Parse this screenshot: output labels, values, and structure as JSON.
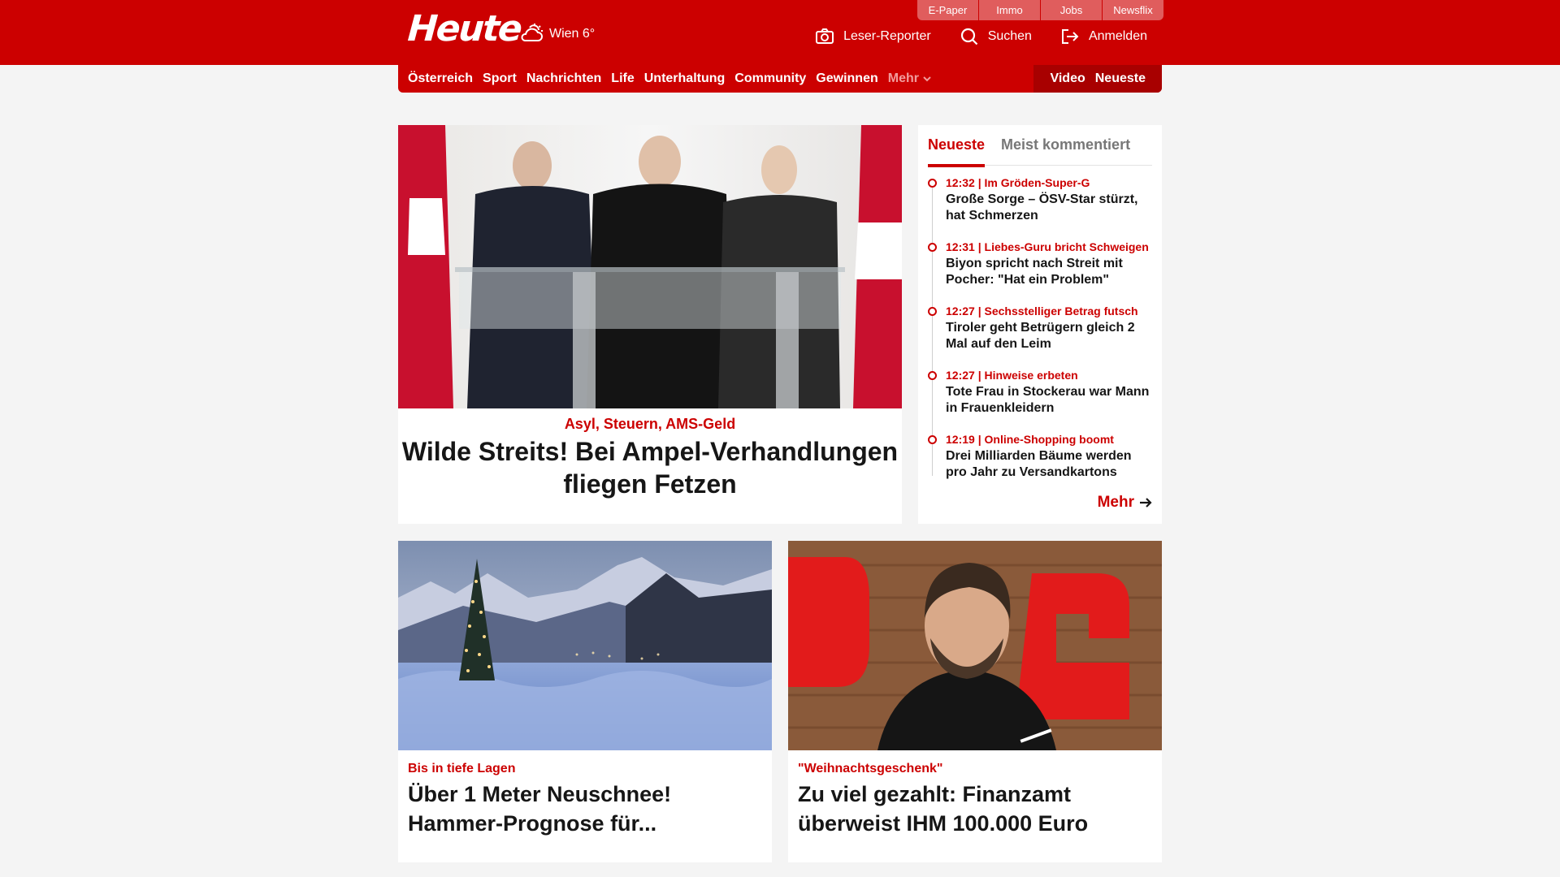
{
  "header": {
    "logo": "Heute",
    "weather": {
      "icon": "cloud-sun-icon",
      "text": "Wien 6°"
    },
    "services": [
      "E-Paper",
      "Immo",
      "Jobs",
      "Newsflix"
    ],
    "actions": [
      {
        "icon": "camera-icon",
        "label": "Leser-Reporter"
      },
      {
        "icon": "search-icon",
        "label": "Suchen"
      },
      {
        "icon": "login-icon",
        "label": "Anmelden"
      }
    ]
  },
  "nav": {
    "items": [
      "Österreich",
      "Sport",
      "Nachrichten",
      "Life",
      "Unterhaltung",
      "Community",
      "Gewinnen"
    ],
    "more": "Mehr",
    "right": [
      "Video",
      "Neueste"
    ]
  },
  "hero": {
    "kicker": "Asyl, Steuern, AMS-Geld",
    "title": "Wilde Streits! Bei Ampel-Verhandlungen fliegen Fetzen"
  },
  "sidebar": {
    "tabs": [
      "Neueste",
      "Meist kommentiert"
    ],
    "active_tab": "Neueste",
    "items": [
      {
        "time": "12:32",
        "topic": "Im Gröden-Super-G",
        "title": "Große Sorge – ÖSV-Star stürzt, hat Schmerzen"
      },
      {
        "time": "12:31",
        "topic": "Liebes-Guru bricht Schweigen",
        "title": "Biyon spricht nach Streit mit Pocher: \"Hat ein Problem\""
      },
      {
        "time": "12:27",
        "topic": "Sechsstelliger Betrag futsch",
        "title": "Tiroler geht Betrügern gleich 2 Mal auf den Leim"
      },
      {
        "time": "12:27",
        "topic": "Hinweise erbeten",
        "title": "Tote Frau in Stockerau war Mann in Frauenkleidern"
      },
      {
        "time": "12:19",
        "topic": "Online-Shopping boomt",
        "title": "Drei Milliarden Bäume werden pro Jahr zu Versandkartons"
      }
    ],
    "more": "Mehr"
  },
  "cards": [
    {
      "kicker": "Bis in tiefe Lagen",
      "title": "Über 1 Meter Neuschnee! Hammer-Prognose für..."
    },
    {
      "kicker": "\"Weihnachtsgeschenk\"",
      "title": "Zu viel gezahlt: Finanzamt überweist IHM 100.000 Euro"
    }
  ],
  "colors": {
    "brand": "#cc0000",
    "nav_dark": "#a80000",
    "service_tab": "#e05d5d",
    "background": "#f4f4f4"
  }
}
